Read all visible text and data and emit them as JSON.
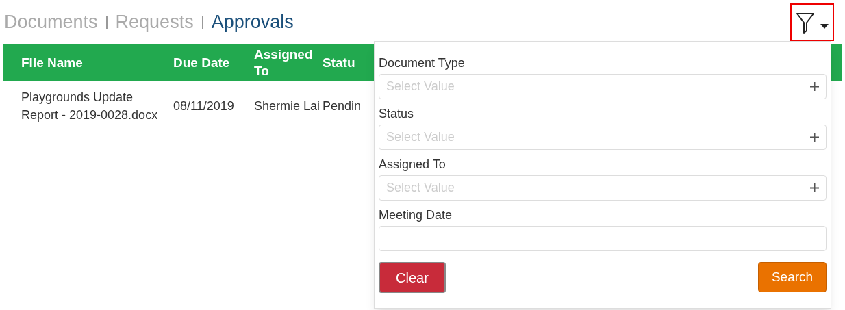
{
  "breadcrumb": [
    {
      "label": "Documents",
      "selected": false
    },
    {
      "label": "Requests",
      "selected": false
    },
    {
      "label": "Approvals",
      "selected": true
    }
  ],
  "table": {
    "columns": [
      "File Name",
      "Due Date",
      "Assigned To",
      "Statu"
    ],
    "rows": [
      [
        "Playgrounds Update Report - 2019-0028.docx",
        "08/11/2019",
        "Shermie Lai",
        "Pendin"
      ]
    ]
  },
  "filter_panel": {
    "fields": [
      {
        "kind": "select",
        "label": "Document Type",
        "placeholder": "Select Value"
      },
      {
        "kind": "select",
        "label": "Status",
        "placeholder": "Select Value"
      },
      {
        "kind": "select",
        "label": "Assigned To",
        "placeholder": "Select Value"
      },
      {
        "kind": "date",
        "label": "Meeting Date"
      }
    ],
    "clear_button": "Clear",
    "search_button": "Search"
  }
}
